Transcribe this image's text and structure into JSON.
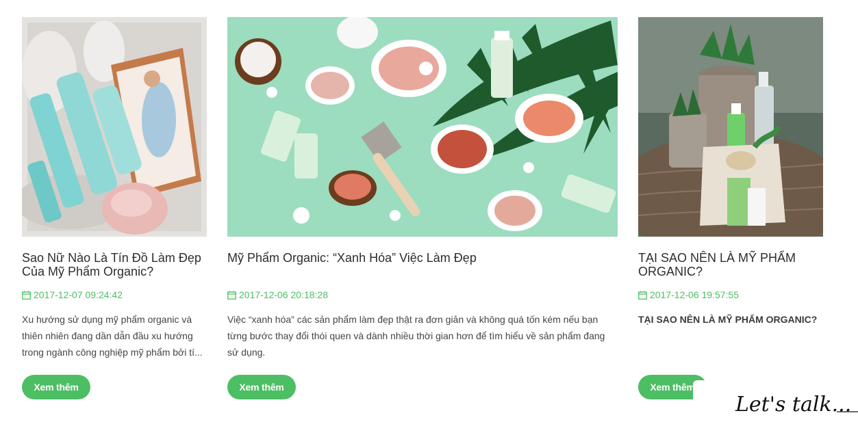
{
  "posts": [
    {
      "title": "Sao Nữ Nào Là Tín Đồ Làm Đẹp Của Mỹ Phẩm Organic?",
      "date": "2017-12-07 09:24:42",
      "excerpt": "Xu hướng sử dụng mỹ phẩm organic và thiên nhiên đang dần dẫn đầu xu hướng trong ngành công nghiệp mỹ phẩm bởi tí...",
      "button": "Xem thêm",
      "image_desc": "kora-products-photo"
    },
    {
      "title": "Mỹ Phẩm Organic: “Xanh Hóa” Việc Làm Đẹp",
      "date": "2017-12-06 20:18:28",
      "excerpt": "Việc “xanh hóa” các sản phẩm làm đẹp thật ra đơn giản và không quá tốn kém nếu bạn từng bước thay đổi thói quen và dành nhiều thời gian hơn để tìm hiểu về sản phẩm đang sử dụng.",
      "button": "Xem thêm",
      "image_desc": "organic-ingredients-photo"
    },
    {
      "title": "TẠI SAO NÊN LÀ MỸ PHẨM ORGANIC?",
      "date": "2017-12-06 19:57:55",
      "excerpt": "TẠI SAO NÊN LÀ MỸ PHẨM ORGANIC?",
      "button": "Xem thêm",
      "image_desc": "succulents-bottles-photo"
    }
  ],
  "chat": {
    "label": "Let's talk..."
  },
  "colors": {
    "accent": "#4cbe63",
    "title": "#2d2d2d",
    "text": "#444444"
  },
  "icons": {
    "date": "calendar-icon"
  }
}
